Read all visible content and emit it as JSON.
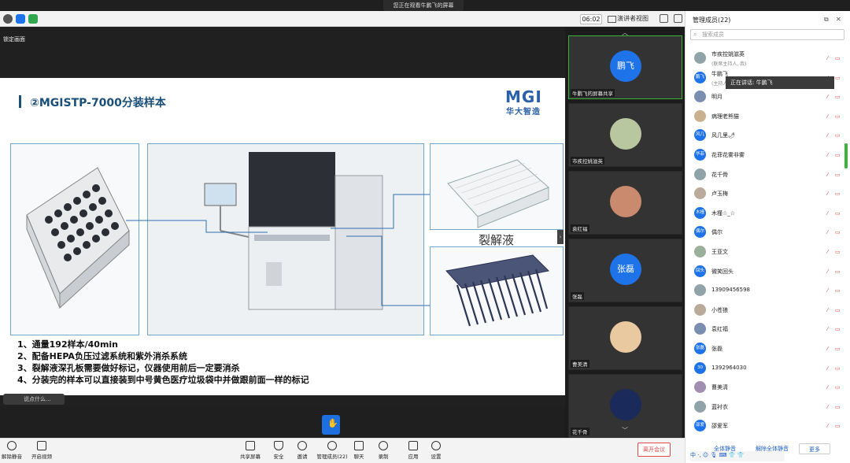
{
  "banner": "您正在观看牛鹏飞的屏幕",
  "toolbar": {
    "timer": "06:02",
    "view_toggle": "演讲者视图"
  },
  "stage": {
    "pin_label": "锁定画面",
    "chat_placeholder": "说点什么..."
  },
  "slide": {
    "title": "②MGISTP-7000分装样本",
    "logo_text": "MGI",
    "logo_cn": "华大智造",
    "lysis_label": "裂解液",
    "bullets": [
      "1、通量192样本/40min",
      "2、配备HEPA负压过滤系统和紫外消杀系统",
      "3、裂解液深孔板需要做好标记，仪器使用前后一定要消杀",
      "4、分装完的样本可以直接装到中号黄色医疗垃圾袋中并做跟前面一样的标记"
    ]
  },
  "video_tiles": [
    {
      "avatar_text": "鹏飞",
      "name": "牛鹏飞的屏幕共享",
      "active": true
    },
    {
      "avatar_text": "",
      "name": "市疾控姚滋英",
      "active": false
    },
    {
      "avatar_text": "",
      "name": "袁红福",
      "active": false
    },
    {
      "avatar_text": "张磊",
      "name": "张磊",
      "active": false
    },
    {
      "avatar_text": "",
      "name": "曹美清",
      "active": false
    },
    {
      "avatar_text": "",
      "name": "花千骨",
      "active": false
    }
  ],
  "members_panel": {
    "title": "管理成员(22)",
    "search_placeholder": "搜索成员",
    "speaking_tip": "正在讲话: 牛鹏飞",
    "members": [
      {
        "avatar": "",
        "name": "市疾控姚滋英",
        "sub": "(联席主持人, 我)"
      },
      {
        "avatar": "鹏飞",
        "name": "牛鹏飞",
        "sub": "(主持人)"
      },
      {
        "avatar": "",
        "name": "明月",
        "sub": ""
      },
      {
        "avatar": "",
        "name": "病理老熊猫",
        "sub": ""
      },
      {
        "avatar": "风几",
        "name": "风几里🌶",
        "sub": ""
      },
      {
        "avatar": "华菲",
        "name": "花菲花雾非雾",
        "sub": ""
      },
      {
        "avatar": "",
        "name": "花千骨",
        "sub": ""
      },
      {
        "avatar": "",
        "name": "卢玉梅",
        "sub": ""
      },
      {
        "avatar": "木槿",
        "name": "木槿☆_☆",
        "sub": ""
      },
      {
        "avatar": "偶尔",
        "name": "偶尔",
        "sub": ""
      },
      {
        "avatar": "",
        "name": "王亚文",
        "sub": ""
      },
      {
        "avatar": "回头",
        "name": "微笑回头",
        "sub": ""
      },
      {
        "avatar": "",
        "name": "13909456598",
        "sub": ""
      },
      {
        "avatar": "",
        "name": "小苍狼",
        "sub": ""
      },
      {
        "avatar": "",
        "name": "袁红福",
        "sub": ""
      },
      {
        "avatar": "张磊",
        "name": "张磊",
        "sub": ""
      },
      {
        "avatar": "30",
        "name": "1392964030",
        "sub": ""
      },
      {
        "avatar": "",
        "name": "曹美清",
        "sub": ""
      },
      {
        "avatar": "",
        "name": "蓝衬衣",
        "sub": ""
      },
      {
        "avatar": "邵爱",
        "name": "邵爱军",
        "sub": ""
      }
    ],
    "mute_all": "全体静音",
    "unmute_all": "解除全体静音",
    "more": "更多"
  },
  "bottom_bar": {
    "items": [
      "解除静音",
      "开启视频",
      "共享屏幕",
      "安全",
      "邀请",
      "管理成员(22)",
      "聊天",
      "录制",
      "应用",
      "设置"
    ],
    "leave": "离开会议"
  },
  "ime": "中 ·, ☺ 🎙 ⌨ 👕 👕"
}
